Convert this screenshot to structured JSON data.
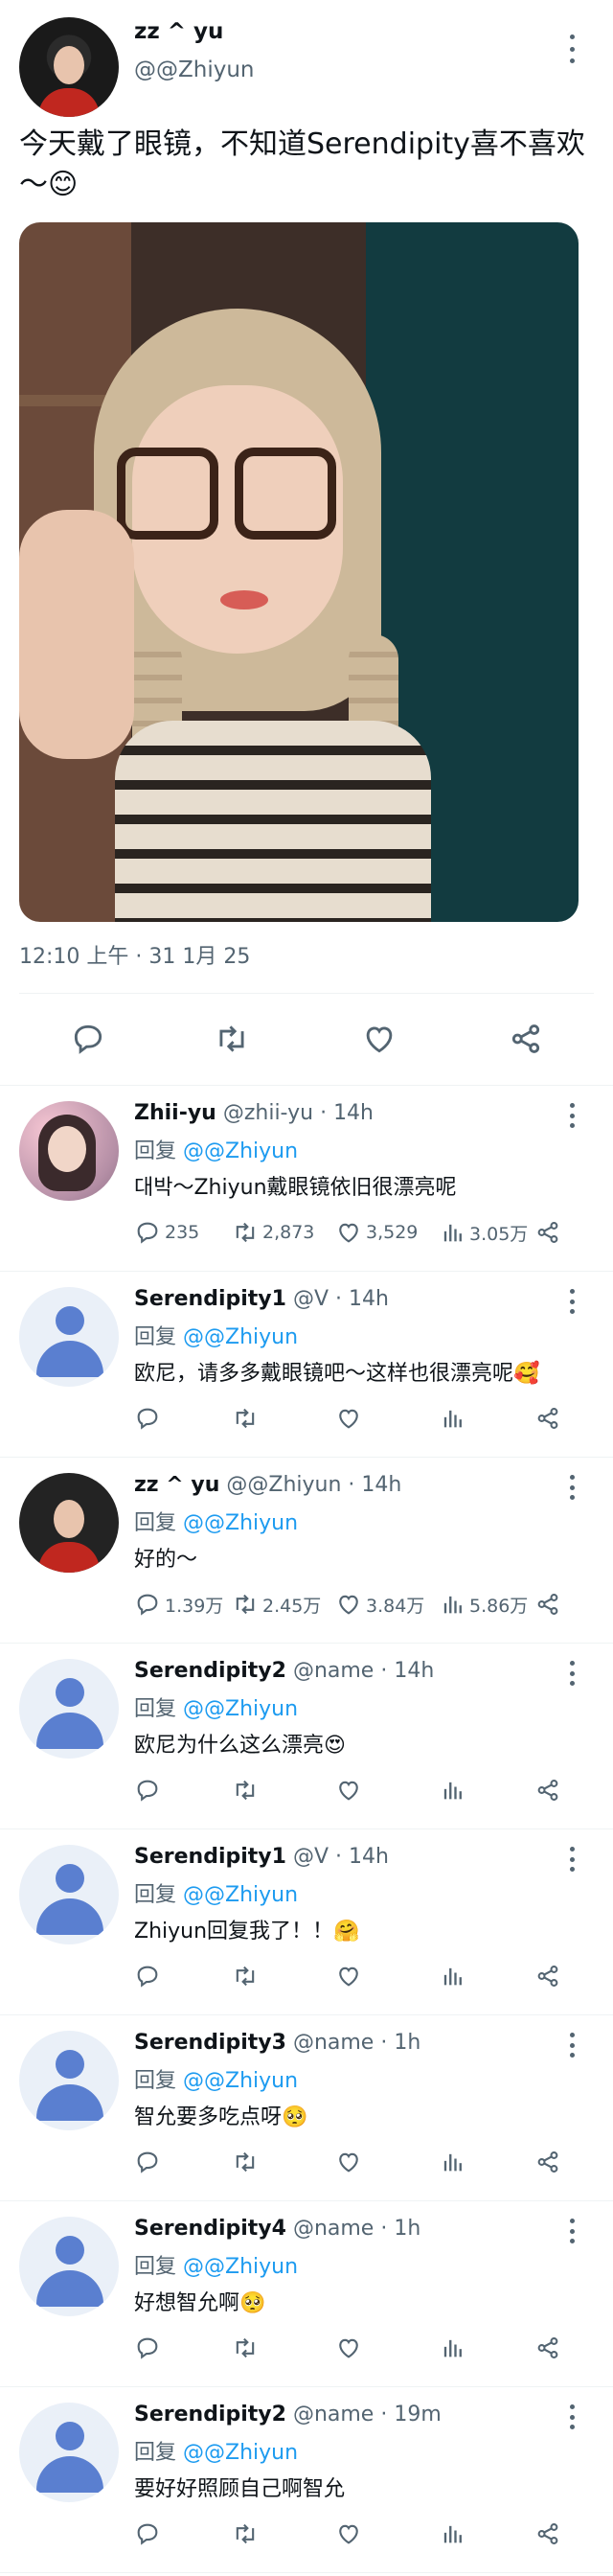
{
  "post": {
    "author_name": "zz ^ yu",
    "author_handle": "@@Zhiyun",
    "text": "今天戴了眼镜，不知道Serendipity喜不喜欢～😊",
    "timestamp": "12:10 上午 · 31 1月 25",
    "actions": [
      "reply-icon",
      "retweet-icon",
      "like-icon",
      "share-icon"
    ]
  },
  "replies": [
    {
      "avatar": "photo-pink",
      "name": "Zhii-yu",
      "handle": "@zhii-yu",
      "time": "· 14h",
      "reply_prefix": "回复",
      "reply_to": "@@Zhiyun",
      "text": "대박～Zhiyun戴眼镜依旧很漂亮呢",
      "stats": {
        "replies": "235",
        "retweets": "2,873",
        "likes": "3,529",
        "views": "3.05万"
      }
    },
    {
      "avatar": "default",
      "name": "Serendipity1",
      "handle": "@V",
      "time": "· 14h",
      "reply_prefix": "回复",
      "reply_to": "@@Zhiyun",
      "text": "欧尼，请多多戴眼镜吧～这样也很漂亮呢🥰",
      "stats": {
        "replies": "",
        "retweets": "",
        "likes": "",
        "views": ""
      }
    },
    {
      "avatar": "photo-dark",
      "name": "zz ^ yu",
      "handle": "@@Zhiyun",
      "time": "· 14h",
      "reply_prefix": "回复",
      "reply_to": "@@Zhiyun",
      "text": "好的～",
      "stats": {
        "replies": "1.39万",
        "retweets": "2.45万",
        "likes": "3.84万",
        "views": "5.86万"
      }
    },
    {
      "avatar": "default",
      "name": "Serendipity2",
      "handle": "@name",
      "time": "· 14h",
      "reply_prefix": "回复",
      "reply_to": "@@Zhiyun",
      "text": "欧尼为什么这么漂亮😍",
      "stats": {
        "replies": "",
        "retweets": "",
        "likes": "",
        "views": ""
      }
    },
    {
      "avatar": "default",
      "name": "Serendipity1",
      "handle": "@V",
      "time": "· 14h",
      "reply_prefix": "回复",
      "reply_to": "@@Zhiyun",
      "text": "Zhiyun回复我了！！🤗",
      "stats": {
        "replies": "",
        "retweets": "",
        "likes": "",
        "views": ""
      }
    },
    {
      "avatar": "default",
      "name": "Serendipity3",
      "handle": "@name",
      "time": "· 1h",
      "reply_prefix": "回复",
      "reply_to": "@@Zhiyun",
      "text": "智允要多吃点呀🥺",
      "stats": {
        "replies": "",
        "retweets": "",
        "likes": "",
        "views": ""
      }
    },
    {
      "avatar": "default",
      "name": "Serendipity4",
      "handle": "@name",
      "time": "· 1h",
      "reply_prefix": "回复",
      "reply_to": "@@Zhiyun",
      "text": "好想智允啊🥺",
      "stats": {
        "replies": "",
        "retweets": "",
        "likes": "",
        "views": ""
      }
    },
    {
      "avatar": "default",
      "name": "Serendipity2",
      "handle": "@name",
      "time": "· 19m",
      "reply_prefix": "回复",
      "reply_to": "@@Zhiyun",
      "text": "要好好照顾自己啊智允",
      "stats": {
        "replies": "",
        "retweets": "",
        "likes": "",
        "views": ""
      }
    }
  ],
  "colors": {
    "accent": "#1d9bf0",
    "muted": "#536471",
    "text": "#0f1419",
    "divider": "#eff3f4"
  }
}
